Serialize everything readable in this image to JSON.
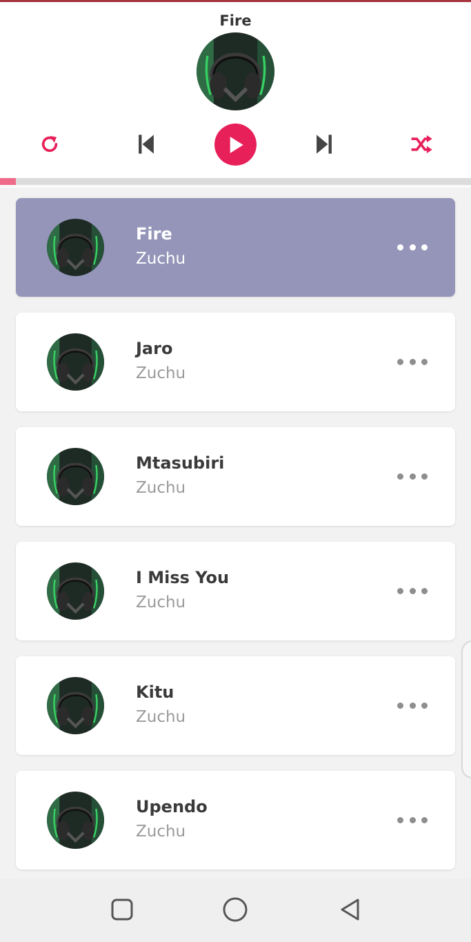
{
  "player": {
    "now_playing_title": "Fire",
    "progress_fraction": 0.033
  },
  "colors": {
    "accent": "#e8205a",
    "active_card": "#9595ba",
    "control_gray": "#444444"
  },
  "icons": {
    "repeat": "repeat-icon",
    "previous": "skip-previous-icon",
    "play": "play-icon",
    "next": "skip-next-icon",
    "shuffle": "shuffle-icon",
    "more": "more-horizontal-icon",
    "nav_recents": "square-icon",
    "nav_home": "circle-icon",
    "nav_back": "triangle-back-icon"
  },
  "songs": [
    {
      "title": "Fire",
      "artist": "Zuchu",
      "active": true
    },
    {
      "title": "Jaro",
      "artist": "Zuchu",
      "active": false
    },
    {
      "title": "Mtasubiri",
      "artist": "Zuchu",
      "active": false
    },
    {
      "title": "I Miss You",
      "artist": "Zuchu",
      "active": false
    },
    {
      "title": "Kitu",
      "artist": "Zuchu",
      "active": false
    },
    {
      "title": "Upendo",
      "artist": "Zuchu",
      "active": false
    }
  ]
}
